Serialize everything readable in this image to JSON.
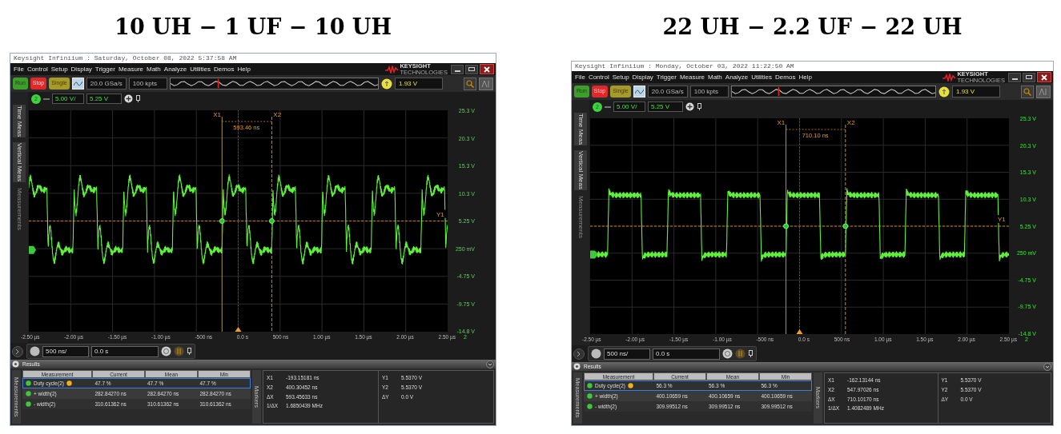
{
  "figures": [
    {
      "heading": "10 UH − 1 UF − 10 UH",
      "title_bar": "Keysight Infiniium : Saturday, October 08, 2022 5:37:58 AM",
      "menu": [
        "File",
        "Control",
        "Setup",
        "Display",
        "Trigger",
        "Measure",
        "Math",
        "Analyze",
        "Utilities",
        "Demos",
        "Help"
      ],
      "brand": {
        "name": "KEYSIGHT",
        "tagline": "TECHNOLOGIES"
      },
      "run_controls": [
        {
          "label": "Run",
          "kind": "run"
        },
        {
          "label": "Stop",
          "kind": "stop"
        },
        {
          "label": "Single",
          "kind": "single"
        }
      ],
      "sample_rate": "20.0 GSa/s",
      "memory_depth": "100 kpts",
      "trigger_level": "1.93 V",
      "side_tabs": [
        {
          "label": "Time Meas",
          "enabled": true
        },
        {
          "label": "Vertical Meas",
          "enabled": true
        },
        {
          "label": "Measurements",
          "enabled": false
        }
      ],
      "channel": {
        "number": "2",
        "scale": "5.00 V/",
        "offset": "5.25 V"
      },
      "y_labels": [
        "25.3 V",
        "20.3 V",
        "15.3 V",
        "10.3 V",
        "5.25 V",
        "250 mV",
        "-4.75 V",
        "-9.75 V",
        "-14.8 V"
      ],
      "x_labels": [
        "-2.50 µs",
        "-2.00 µs",
        "-1.50 µs",
        "-1.00 µs",
        "-500 ns",
        "0.0 s",
        "500 ns",
        "1.00 µs",
        "1.50 µs",
        "2.00 µs",
        "2.50 µs"
      ],
      "channel_marker": "2",
      "cursors": {
        "x1": "X1",
        "x2": "X2",
        "delta": "593.46 ns",
        "y_marker": "Y1"
      },
      "trace": {
        "kind": "ringing"
      },
      "timebase": {
        "scale": "500 ns/",
        "position": "0.0 s"
      },
      "results": {
        "title": "Results",
        "tab": "Measurements",
        "columns": [
          "Measurement",
          "Current",
          "Mean",
          "Min"
        ],
        "rows": [
          {
            "cells": [
              "Duty cycle(2)",
              "47.7 %",
              "47.7 %",
              "47.7 %"
            ],
            "selected": true
          },
          {
            "cells": [
              "+ width(2)",
              "282.84270 ns",
              "282.84270 ns",
              "282.84270 ns"
            ],
            "selected": false
          },
          {
            "cells": [
              "- width(2)",
              "310.61362 ns",
              "310.61362 ns",
              "310.61362 ns"
            ],
            "selected": false
          }
        ]
      },
      "markers": {
        "tab": "Markers",
        "left": [
          {
            "label": "X1",
            "value": "-193.15181 ns"
          },
          {
            "label": "X2",
            "value": "400.30452 ns"
          },
          {
            "label": "ΔX",
            "value": "593.45633 ns"
          },
          {
            "label": "1/ΔX",
            "value": "1.6850439 MHz"
          }
        ],
        "right": [
          {
            "label": "Y1",
            "value": "5.5370 V"
          },
          {
            "label": "Y2",
            "value": "5.5370 V"
          },
          {
            "label": "ΔY",
            "value": "0.0 V"
          }
        ]
      }
    },
    {
      "heading": "22 UH − 2.2 UF − 22 UH",
      "title_bar": "Keysight Infiniium : Monday, October 03, 2022 11:22:50 AM",
      "menu": [
        "File",
        "Control",
        "Setup",
        "Display",
        "Trigger",
        "Measure",
        "Math",
        "Analyze",
        "Utilities",
        "Demos",
        "Help"
      ],
      "brand": {
        "name": "KEYSIGHT",
        "tagline": "TECHNOLOGIES"
      },
      "run_controls": [
        {
          "label": "Run",
          "kind": "run"
        },
        {
          "label": "Stop",
          "kind": "stop"
        },
        {
          "label": "Single",
          "kind": "single"
        }
      ],
      "sample_rate": "20.0 GSa/s",
      "memory_depth": "100 kpts",
      "trigger_level": "1.93 V",
      "side_tabs": [
        {
          "label": "Time Meas",
          "enabled": true
        },
        {
          "label": "Vertical Meas",
          "enabled": true
        },
        {
          "label": "Measurements",
          "enabled": false
        }
      ],
      "channel": {
        "number": "2",
        "scale": "5.00 V/",
        "offset": "5.25 V"
      },
      "y_labels": [
        "25.3 V",
        "20.3 V",
        "15.3 V",
        "10.3 V",
        "5.25 V",
        "250 mV",
        "-4.75 V",
        "-9.75 V",
        "-14.8 V"
      ],
      "x_labels": [
        "-2.50 µs",
        "-2.00 µs",
        "-1.50 µs",
        "-1.00 µs",
        "-500 ns",
        "0.0 s",
        "500 ns",
        "1.00 µs",
        "1.50 µs",
        "2.00 µs",
        "2.50 µs"
      ],
      "channel_marker": "2",
      "cursors": {
        "x1": "X1",
        "x2": "X2",
        "delta": "710.10 ns",
        "y_marker": "Y1"
      },
      "trace": {
        "kind": "clean"
      },
      "timebase": {
        "scale": "500 ns/",
        "position": "0.0 s"
      },
      "results": {
        "title": "Results",
        "tab": "Measurements",
        "columns": [
          "Measurement",
          "Current",
          "Mean",
          "Min"
        ],
        "rows": [
          {
            "cells": [
              "Duty cycle(2)",
              "56.3 %",
              "56.3 %",
              "56.3 %"
            ],
            "selected": true
          },
          {
            "cells": [
              "+ width(2)",
              "400.10659 ns",
              "400.10659 ns",
              "400.10659 ns"
            ],
            "selected": false
          },
          {
            "cells": [
              "- width(2)",
              "309.99512 ns",
              "309.99512 ns",
              "309.99512 ns"
            ],
            "selected": false
          }
        ]
      },
      "markers": {
        "tab": "Markers",
        "left": [
          {
            "label": "X1",
            "value": "-162.13144 ns"
          },
          {
            "label": "X2",
            "value": "547.97026 ns"
          },
          {
            "label": "ΔX",
            "value": "710.10170 ns"
          },
          {
            "label": "1/ΔX",
            "value": "1.4082489 MHz"
          }
        ],
        "right": [
          {
            "label": "Y1",
            "value": "5.5370 V"
          },
          {
            "label": "Y2",
            "value": "5.5370 V"
          },
          {
            "label": "ΔY",
            "value": "0.0 V"
          }
        ]
      }
    }
  ]
}
